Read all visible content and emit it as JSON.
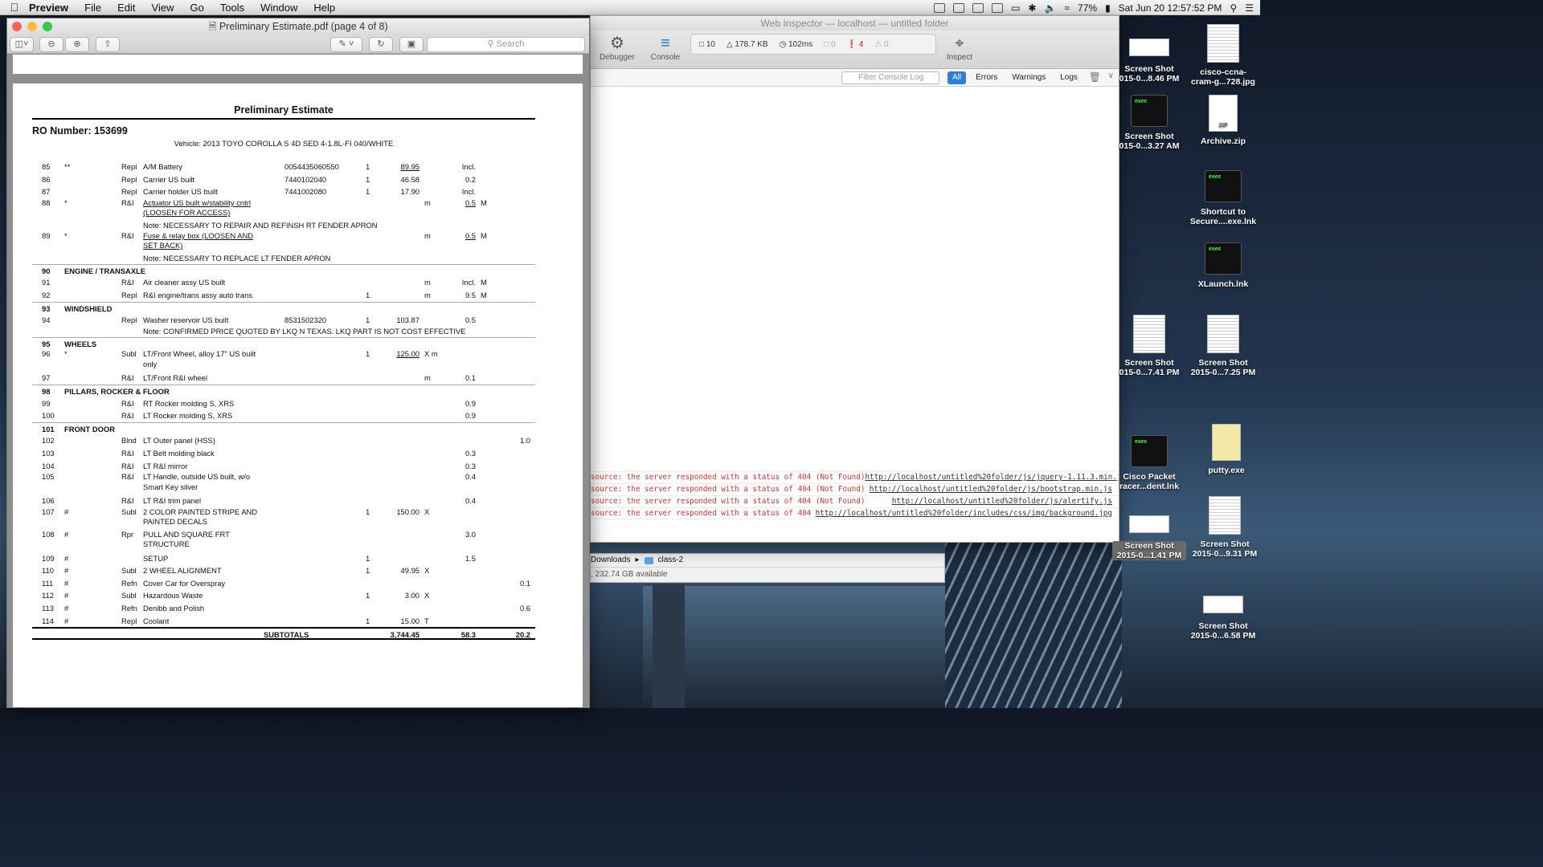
{
  "menubar": {
    "app": "Preview",
    "items": [
      "File",
      "Edit",
      "View",
      "Go",
      "Tools",
      "Window",
      "Help"
    ],
    "battery": "77%",
    "datetime": "Sat Jun 20  12:57:52 PM"
  },
  "inspector": {
    "title": "Web Inspector — localhost — untitled folder",
    "debugger": "Debugger",
    "console": "Console",
    "inspect": "Inspect",
    "stats": {
      "resources": "10",
      "size": "178.7 KB",
      "time": "102ms",
      "logs": "0",
      "errors": "4",
      "warnings": "0"
    },
    "filter_placeholder": "Filter Console Log",
    "tabs": [
      "All",
      "Errors",
      "Warnings",
      "Logs"
    ],
    "lines": [
      {
        "msg": "source: the server responded with a status of 404 (Not Found)",
        "url": "http://localhost/untitled%20folder/js/jquery-1.11.3.min.js"
      },
      {
        "msg": "source: the server responded with a status of 404 (Not Found)",
        "url": "http://localhost/untitled%20folder/js/bootstrap.min.js"
      },
      {
        "msg": "source: the server responded with a status of 404 (Not Found)",
        "url": "http://localhost/untitled%20folder/js/alertify.js"
      },
      {
        "msg": "source: the server responded with a status of 404",
        "url": "http://localhost/untitled%20folder/includes/css/img/background.jpg"
      }
    ]
  },
  "finder": {
    "path1": "Downloads",
    "path2": "class-2",
    "available": ", 232.74 GB available"
  },
  "preview": {
    "title": "Preliminary Estimate.pdf (page 4 of 8)",
    "search": "Search"
  },
  "doc": {
    "title": "Preliminary Estimate",
    "ro": "RO Number: 153699",
    "vehicle": "Vehicle: 2013 TOYO COROLLA S 4D SED 4-1.8L-FI 040/WHITE",
    "subtotal_label": "SUBTOTALS",
    "subtotal_price": "3,744.45",
    "subtotal_labor": "58.3",
    "subtotal_paint": "20.2"
  },
  "rows": [
    {
      "ln": "85",
      "fl": "**",
      "op": "Repl",
      "d1": "A/M Battery",
      "pn": "0054435060550",
      "q": "1",
      "pr": "89.95",
      "pru": true,
      "lb": "Incl."
    },
    {
      "ln": "86",
      "op": "Repl",
      "d1": "Carrier US built",
      "pn": "7440102040",
      "q": "1",
      "pr": "46.58",
      "lb": "0.2"
    },
    {
      "ln": "87",
      "op": "Repl",
      "d1": "Carrier holder US built",
      "pn": "7441002080",
      "q": "1",
      "pr": "17.90",
      "lb": "Incl."
    },
    {
      "ln": "88",
      "fl": "*",
      "op": "R&I",
      "d1": "Actuator US built w/stability cntrl",
      "d2": "(LOOSEN FOR ACCESS)",
      "du": true,
      "x": "m",
      "lb": "0.5",
      "lbu": true,
      "ty": "M"
    },
    {
      "note": "Note: NECESSARY TO REPAIR AND REFINSH RT FENDER APRON"
    },
    {
      "ln": "89",
      "fl": "*",
      "op": "R&I",
      "d1": "Fuse & relay box (LOOSEN AND",
      "d2": "SET BACK)",
      "du": true,
      "x": "m",
      "lb": "0.5",
      "lbu": true,
      "ty": "M"
    },
    {
      "note": "Note: NECESSARY TO REPLACE LT FENDER APRON"
    },
    {
      "ln": "90",
      "sec": "ENGINE / TRANSAXLE"
    },
    {
      "ln": "91",
      "op": "R&I",
      "d1": "Air cleaner assy US built",
      "x": "m",
      "lb": "Incl.",
      "ty": "M"
    },
    {
      "ln": "92",
      "op": "Repl",
      "d1": "R&I engine/trans assy auto trans",
      "q": "1",
      "x": "m",
      "lb": "9.5",
      "ty": "M"
    },
    {
      "ln": "93",
      "sec": "WINDSHIELD"
    },
    {
      "ln": "94",
      "op": "Repl",
      "d1": "Washer reservoir US built",
      "pn": "8531502320",
      "q": "1",
      "pr": "103.87",
      "lb": "0.5"
    },
    {
      "note": "Note: CONFIRMED PRICE QUOTED BY LKQ N TEXAS. LKQ PART IS NOT COST EFFECTIVE"
    },
    {
      "ln": "95",
      "sec": "WHEELS"
    },
    {
      "ln": "96",
      "fl": "*",
      "op": "Subl",
      "d1": "LT/Front Wheel, alloy 17\" US built",
      "d2": "only",
      "q": "1",
      "pr": "125.00",
      "pru": true,
      "x": "X m"
    },
    {
      "ln": "97",
      "op": "R&I",
      "d1": "LT/Front R&I wheel",
      "x": "m",
      "lb": "0.1"
    },
    {
      "ln": "98",
      "sec": "PILLARS, ROCKER & FLOOR"
    },
    {
      "ln": "99",
      "op": "R&I",
      "d1": "RT Rocker molding S, XRS",
      "lb": "0.9"
    },
    {
      "ln": "100",
      "op": "R&I",
      "d1": "LT Rocker molding S, XRS",
      "lb": "0.9"
    },
    {
      "ln": "101",
      "sec": "FRONT DOOR"
    },
    {
      "ln": "102",
      "op": "Blnd",
      "d1": "LT Outer panel (HSS)",
      "pt": "1.0"
    },
    {
      "ln": "103",
      "op": "R&I",
      "d1": "LT Belt molding black",
      "lb": "0.3"
    },
    {
      "ln": "104",
      "op": "R&I",
      "d1": "LT R&I mirror",
      "lb": "0.3"
    },
    {
      "ln": "105",
      "op": "R&I",
      "d1": "LT Handle, outside US built, w/o",
      "d2": "Smart Key silver",
      "lb": "0.4"
    },
    {
      "ln": "106",
      "op": "R&I",
      "d1": "LT R&I trim panel",
      "lb": "0.4"
    },
    {
      "ln": "107",
      "fl": "#",
      "op": "Subl",
      "d1": "2 COLOR PAINTED STRIPE AND",
      "d2": "PAINTED DECALS",
      "q": "1",
      "pr": "150.00",
      "x": "X"
    },
    {
      "ln": "108",
      "fl": "#",
      "op": "Rpr",
      "d1": "PULL AND SQUARE FRT",
      "d2": "STRUCTURE",
      "lb": "3.0"
    },
    {
      "ln": "109",
      "fl": "#",
      "d1": "SETUP",
      "q": "1",
      "lb": "1.5"
    },
    {
      "ln": "110",
      "fl": "#",
      "op": "Subl",
      "d1": "2 WHEEL ALIGNMENT",
      "q": "1",
      "pr": "49.95",
      "x": "X"
    },
    {
      "ln": "111",
      "fl": "#",
      "op": "Refn",
      "d1": "Cover Car for Overspray",
      "pt": "0.1"
    },
    {
      "ln": "112",
      "fl": "#",
      "op": "Subl",
      "d1": "Hazardous Waste",
      "q": "1",
      "pr": "3.00",
      "x": "X"
    },
    {
      "ln": "113",
      "fl": "#",
      "op": "Refn",
      "d1": "Denibb and Polish",
      "pt": "0.6"
    },
    {
      "ln": "114",
      "fl": "#",
      "op": "Repl",
      "d1": "Coolant",
      "q": "1",
      "pr": "15.00",
      "x": "T"
    }
  ],
  "desktop": [
    {
      "l1": "Screen Shot",
      "l2": "015-0...8.46 PM",
      "kind": "thumb"
    },
    {
      "l1": "cisco-ccna-",
      "l2": "cram-g...728.jpg",
      "kind": "doc"
    },
    {
      "l1": "Screen Shot",
      "l2": "015-0...3.27 AM",
      "kind": "term"
    },
    {
      "l1": "Archive.zip",
      "l2": "",
      "kind": "zip"
    },
    {
      "l1": "Shortcut to",
      "l2": "Secure....exe.lnk",
      "kind": "term"
    },
    {
      "l1": "XLaunch.lnk",
      "l2": "",
      "kind": "term"
    },
    {
      "l1": "Screen Shot",
      "l2": "015-0...7.41 PM",
      "kind": "doc"
    },
    {
      "l1": "Screen Shot",
      "l2": "2015-0...7.25 PM",
      "kind": "doc"
    },
    {
      "l1": "Cisco Packet",
      "l2": "racer...dent.lnk",
      "kind": "term"
    },
    {
      "l1": "putty.exe",
      "l2": "",
      "kind": "file"
    },
    {
      "l1": "Screen Shot",
      "l2": "2015-0...1.41 PM",
      "kind": "thumb"
    },
    {
      "l1": "Screen Shot",
      "l2": "2015-0...9.31 PM",
      "kind": "doc"
    },
    {
      "l1": "Screen Shot",
      "l2": "2015-0...6.58 PM",
      "kind": "thumb"
    }
  ]
}
